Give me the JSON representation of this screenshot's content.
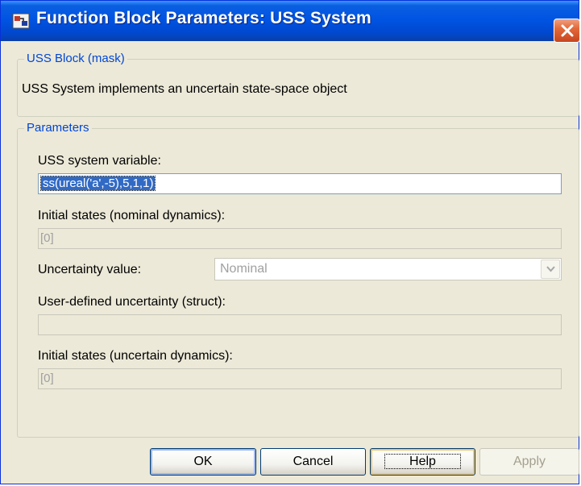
{
  "window": {
    "title": "Function Block Parameters: USS System",
    "icons": {
      "app": "simulink-block-icon",
      "close": "close-icon"
    },
    "colors": {
      "titlebar": "#0054e3",
      "legend": "#0046d5",
      "close": "#e36a3a"
    }
  },
  "mask_group": {
    "legend": "USS Block (mask)",
    "description": "USS System implements an uncertain state-space object"
  },
  "parameters_group": {
    "legend": "Parameters",
    "uss_variable": {
      "label": "USS system variable:",
      "value": "ss(ureal('a',-5),5,1,1)"
    },
    "initial_states_nominal": {
      "label": "Initial states (nominal dynamics):",
      "value": "[0]"
    },
    "uncertainty_value": {
      "label": "Uncertainty value:",
      "selected": "Nominal"
    },
    "user_defined_uncertainty": {
      "label": "User-defined uncertainty (struct):",
      "value": ""
    },
    "initial_states_uncertain": {
      "label": "Initial states (uncertain dynamics):",
      "value": "[0]"
    }
  },
  "buttons": {
    "ok": "OK",
    "cancel": "Cancel",
    "help": "Help",
    "apply": "Apply"
  }
}
